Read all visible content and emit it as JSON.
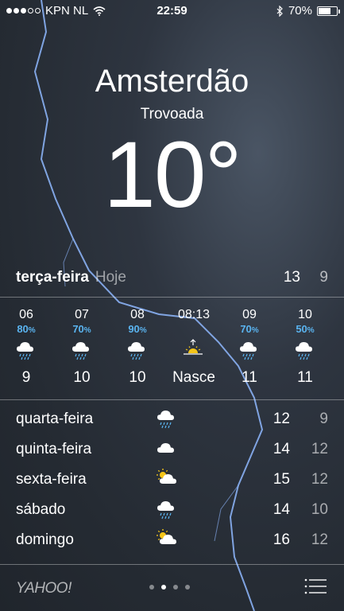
{
  "status_bar": {
    "carrier": "KPN NL",
    "time": "22:59",
    "battery": "70%",
    "battery_level": 0.7
  },
  "location": {
    "city": "Amsterdão",
    "condition": "Trovoada",
    "temperature": "10°"
  },
  "today": {
    "day": "terça-feira",
    "label": "Hoje",
    "high": "13",
    "low": "9"
  },
  "hourly": [
    {
      "hour": "06",
      "pct": "80",
      "icon": "rain-cloud-icon",
      "temp": "9"
    },
    {
      "hour": "07",
      "pct": "70",
      "icon": "rain-cloud-icon",
      "temp": "10"
    },
    {
      "hour": "08",
      "pct": "90",
      "icon": "rain-cloud-icon",
      "temp": "10"
    },
    {
      "hour": "08:13",
      "pct": "",
      "icon": "sunrise-icon",
      "temp": "Nasce"
    },
    {
      "hour": "09",
      "pct": "70",
      "icon": "rain-cloud-icon",
      "temp": "11"
    },
    {
      "hour": "10",
      "pct": "50",
      "icon": "rain-cloud-icon",
      "temp": "11"
    }
  ],
  "pct_unit": "%",
  "daily": [
    {
      "day": "quarta-feira",
      "icon": "rain-cloud-icon",
      "high": "12",
      "low": "9"
    },
    {
      "day": "quinta-feira",
      "icon": "cloud-icon",
      "high": "14",
      "low": "12"
    },
    {
      "day": "sexta-feira",
      "icon": "partly-sunny-icon",
      "high": "15",
      "low": "12"
    },
    {
      "day": "sábado",
      "icon": "rain-cloud-icon",
      "high": "14",
      "low": "10"
    },
    {
      "day": "domingo",
      "icon": "partly-sunny-icon",
      "high": "16",
      "low": "12"
    }
  ],
  "footer": {
    "brand": "YAHOO!",
    "pages": 4,
    "active_page": 1
  },
  "colors": {
    "precip": "#5ab4f0",
    "lightning": "#8fb8ff"
  }
}
